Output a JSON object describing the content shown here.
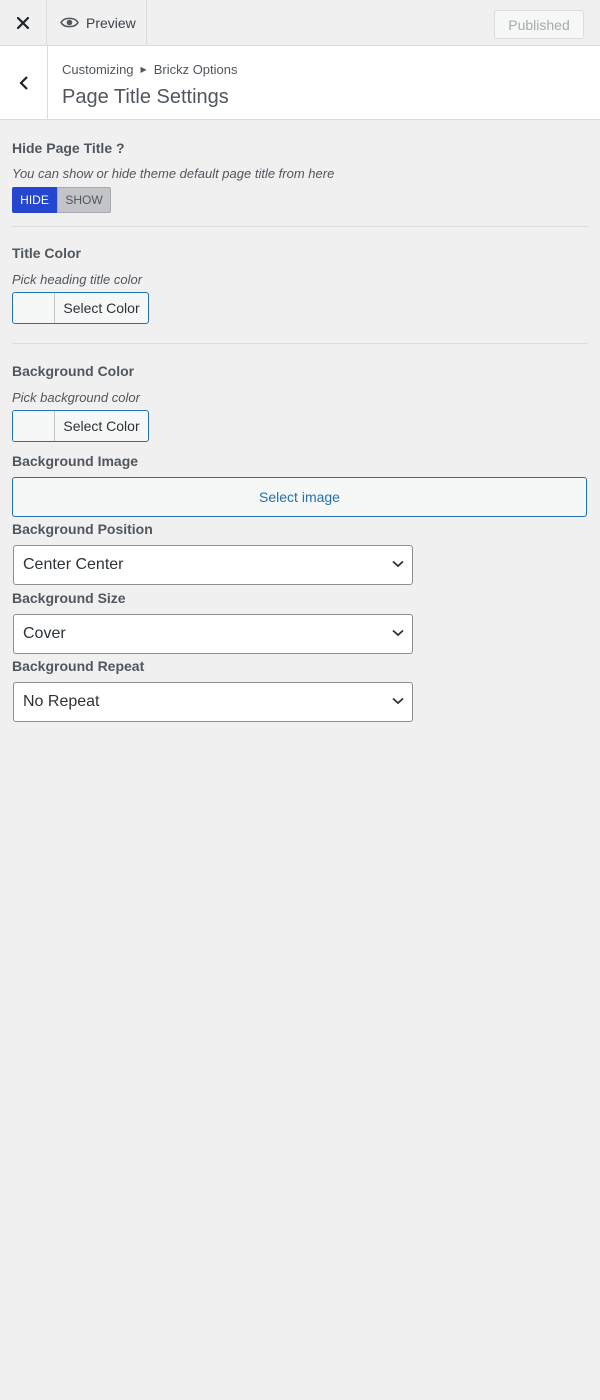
{
  "header": {
    "close_icon": "close-icon",
    "preview_label": "Preview",
    "preview_icon": "eye-icon",
    "published_label": "Published"
  },
  "section": {
    "breadcrumb_root": "Customizing",
    "breadcrumb_parent": "Brickz Options",
    "title": "Page Title Settings"
  },
  "controls": {
    "hide_title": {
      "title": "Hide Page Title ?",
      "description": "You can show or hide theme default page title from here",
      "option_hide": "HIDE",
      "option_show": "SHOW",
      "selected": "HIDE"
    },
    "title_color": {
      "title": "Title Color",
      "description": "Pick heading title color",
      "button_label": "Select Color"
    },
    "background_color": {
      "title": "Background Color",
      "description": "Pick background color",
      "button_label": "Select Color"
    },
    "background_image": {
      "title": "Background Image",
      "button_label": "Select image"
    },
    "background_position": {
      "title": "Background Position",
      "value": "Center Center"
    },
    "background_size": {
      "title": "Background Size",
      "value": "Cover"
    },
    "background_repeat": {
      "title": "Background Repeat",
      "value": "No Repeat"
    }
  },
  "colors": {
    "accent": "#2271b1",
    "toggle_active": "#2547cf",
    "panel_bg": "#f0f0f1"
  }
}
